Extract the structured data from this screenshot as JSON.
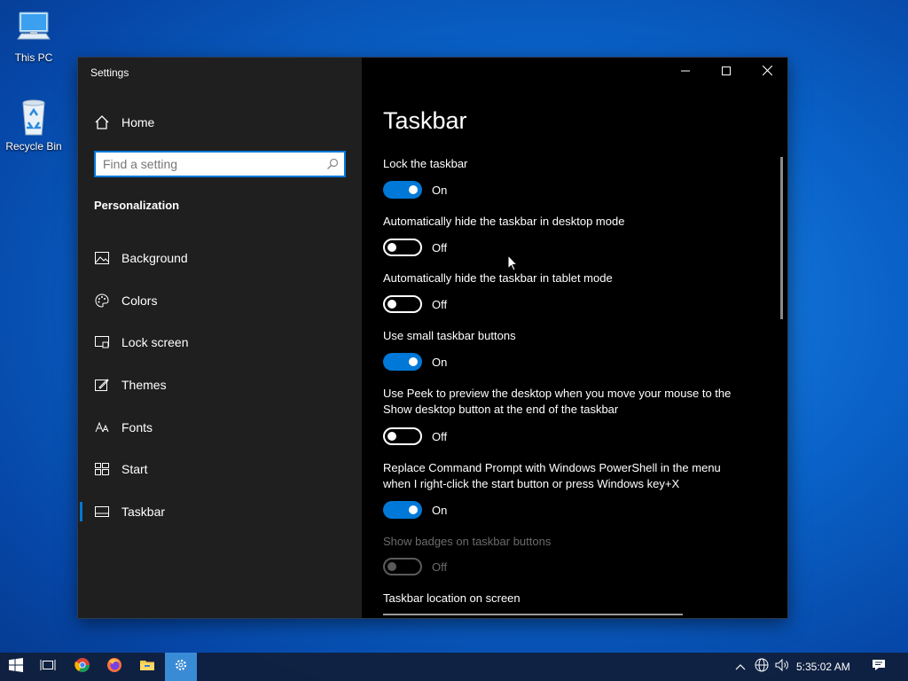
{
  "desktop": {
    "icons": [
      {
        "label": "This PC"
      },
      {
        "label": "Recycle Bin"
      }
    ]
  },
  "window": {
    "title": "Settings",
    "controls": {
      "minimize": "minimize-icon",
      "maximize": "maximize-icon",
      "close": "close-icon"
    }
  },
  "sidebar": {
    "home_label": "Home",
    "search_placeholder": "Find a setting",
    "section": "Personalization",
    "items": [
      {
        "label": "Background",
        "icon": "picture-icon",
        "active": false
      },
      {
        "label": "Colors",
        "icon": "palette-icon",
        "active": false
      },
      {
        "label": "Lock screen",
        "icon": "lock-screen-icon",
        "active": false
      },
      {
        "label": "Themes",
        "icon": "brush-icon",
        "active": false
      },
      {
        "label": "Fonts",
        "icon": "font-icon",
        "active": false
      },
      {
        "label": "Start",
        "icon": "start-grid-icon",
        "active": false
      },
      {
        "label": "Taskbar",
        "icon": "taskbar-icon",
        "active": true
      }
    ]
  },
  "content": {
    "title": "Taskbar",
    "settings": [
      {
        "label": "Lock the taskbar",
        "state": "On",
        "on": true,
        "enabled": true
      },
      {
        "label": "Automatically hide the taskbar in desktop mode",
        "state": "Off",
        "on": false,
        "enabled": true
      },
      {
        "label": "Automatically hide the taskbar in tablet mode",
        "state": "Off",
        "on": false,
        "enabled": true
      },
      {
        "label": "Use small taskbar buttons",
        "state": "On",
        "on": true,
        "enabled": true
      },
      {
        "label_line1": "Use Peek to preview the desktop when you move your mouse to the",
        "label_line2": "Show desktop button at the end of the taskbar",
        "state": "Off",
        "on": false,
        "enabled": true
      },
      {
        "label_line1": "Replace Command Prompt with Windows PowerShell in the menu",
        "label_line2": "when I right-click the start button or press Windows key+X",
        "state": "On",
        "on": true,
        "enabled": true
      },
      {
        "label": "Show badges on taskbar buttons",
        "state": "Off",
        "on": false,
        "enabled": false
      }
    ],
    "location_label": "Taskbar location on screen"
  },
  "taskbar": {
    "buttons": [
      "start-icon",
      "task-view-icon",
      "chrome-icon",
      "firefox-icon",
      "file-explorer-icon",
      "settings-icon"
    ],
    "tray": [
      "chevron-up-icon",
      "network-icon",
      "volume-icon",
      "notification-icon"
    ],
    "clock": "5:35:02 AM"
  },
  "colors": {
    "accent": "#0078d7",
    "sidebar_bg": "#1f1f1f",
    "content_bg": "#000000"
  }
}
